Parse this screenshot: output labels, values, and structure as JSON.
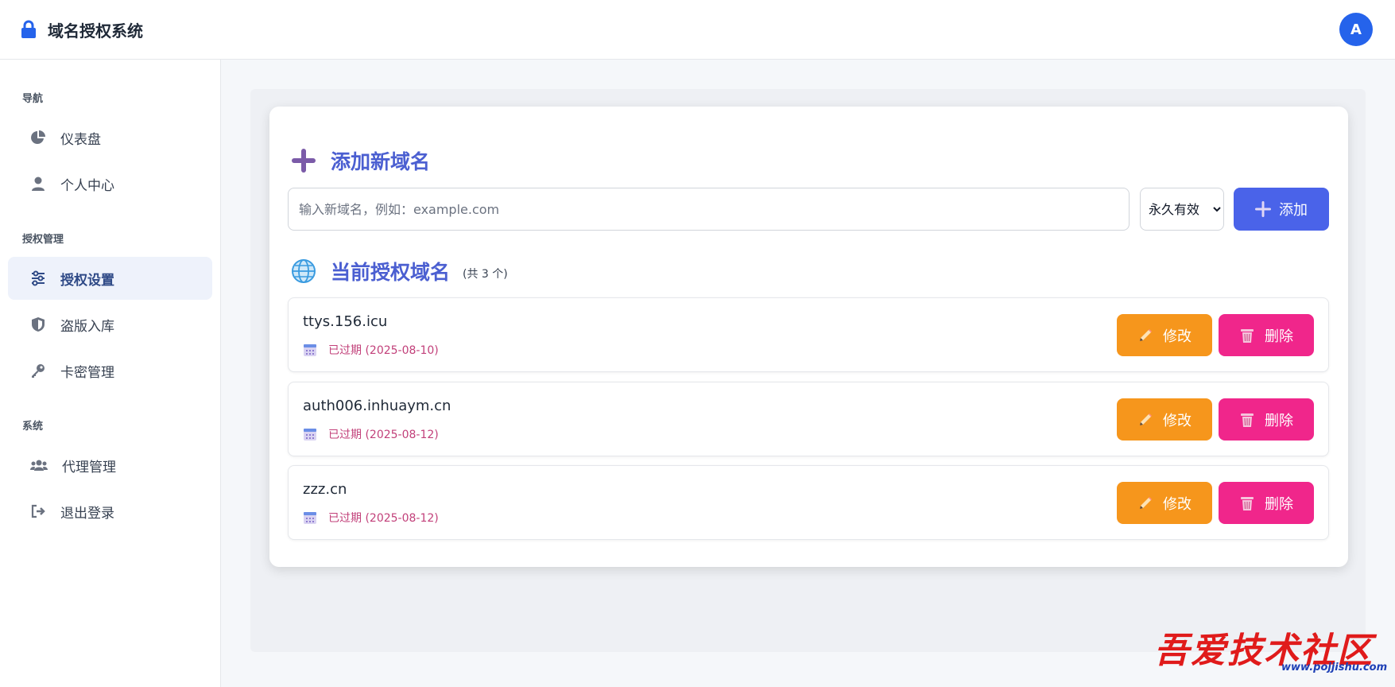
{
  "header": {
    "title": "域名授权系统",
    "avatar_letter": "A",
    "brand_color": "#2563eb"
  },
  "sidebar": {
    "sections": [
      {
        "label": "导航",
        "items": [
          {
            "label": "仪表盘",
            "icon": "pie-chart-icon",
            "active": false
          },
          {
            "label": "个人中心",
            "icon": "user-icon",
            "active": false
          }
        ]
      },
      {
        "label": "授权管理",
        "items": [
          {
            "label": "授权设置",
            "icon": "sliders-icon",
            "active": true
          },
          {
            "label": "盗版入库",
            "icon": "shield-icon",
            "active": false
          },
          {
            "label": "卡密管理",
            "icon": "key-icon",
            "active": false
          }
        ]
      },
      {
        "label": "系统",
        "items": [
          {
            "label": "代理管理",
            "icon": "users-icon",
            "active": false
          },
          {
            "label": "退出登录",
            "icon": "logout-icon",
            "active": false
          }
        ]
      }
    ]
  },
  "add_section": {
    "title": "添加新域名",
    "input_placeholder": "输入新域名，例如：example.com",
    "input_value": "",
    "period_selected": "永久有效",
    "add_label": "添加"
  },
  "current_section": {
    "title": "当前授权域名",
    "count_text": "(共 3 个)"
  },
  "domains": [
    {
      "name": "ttys.156.icu",
      "status": "已过期 (2025-08-10)"
    },
    {
      "name": "auth006.inhuaym.cn",
      "status": "已过期 (2025-08-12)"
    },
    {
      "name": "zzz.cn",
      "status": "已过期 (2025-08-12)"
    }
  ],
  "row_actions": {
    "edit_label": "修改",
    "delete_label": "删除"
  },
  "watermark": {
    "text": "吾爱技术社区",
    "url": "www.pojjishu.com"
  },
  "colors": {
    "accent": "#4a63e9",
    "edit": "#f6961c",
    "delete": "#f0268b",
    "expired": "#c2407a",
    "section_title": "#4b5fd1"
  }
}
